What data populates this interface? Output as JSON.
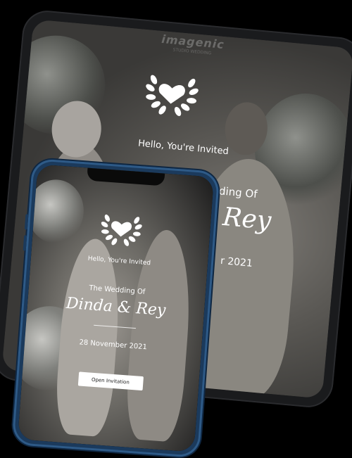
{
  "tablet": {
    "watermark": "imagenic",
    "watermark_sub": "STUDIO WEDDING",
    "greeting": "Hello, You're Invited",
    "wedding_of_partial": "e Wedding Of",
    "names_partial": "& Rey",
    "date_partial": "r 2021"
  },
  "phone": {
    "greeting": "Hello, You're Invited",
    "wedding_of": "The Wedding Of",
    "names": "Dinda & Rey",
    "date": "28 November 2021",
    "open_button_label": "Open Invitation"
  },
  "colors": {
    "background": "#000000",
    "tablet_frame": "#1a1b1d",
    "phone_frame": "#1b3a5c",
    "text": "#ffffff",
    "button_bg": "#ffffff"
  },
  "icons": {
    "emblem": "heart-laurel-wreath-icon"
  }
}
